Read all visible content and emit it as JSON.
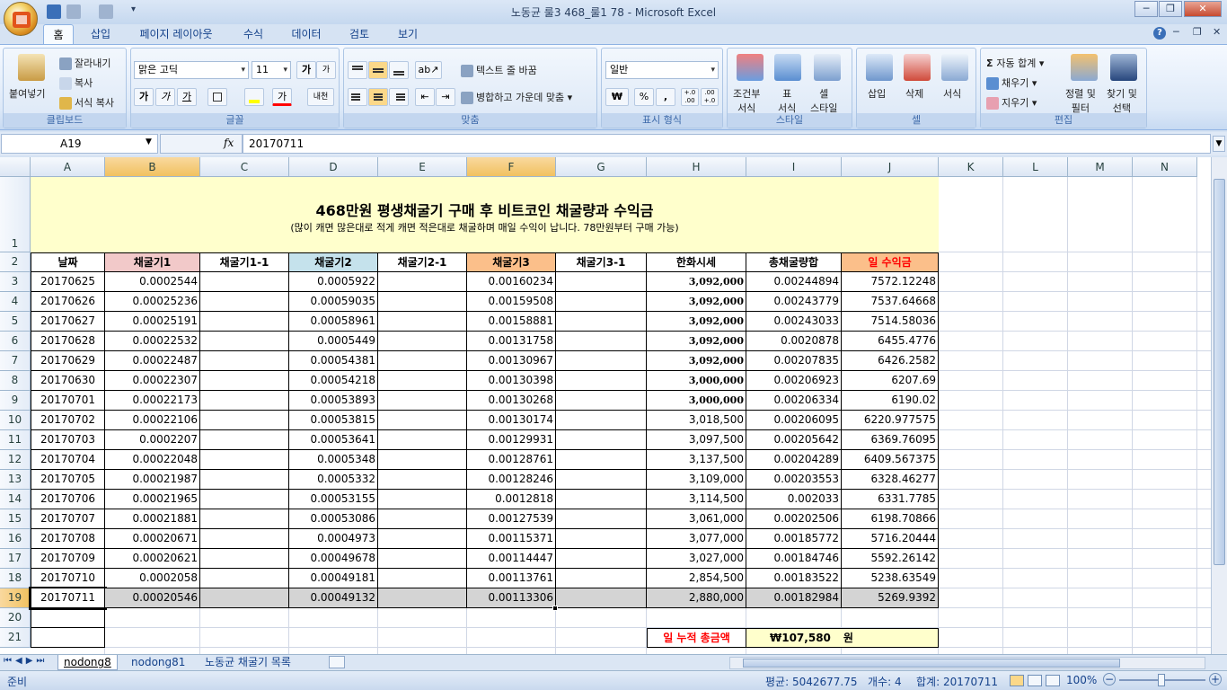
{
  "window": {
    "title": "노동균 룰3 468_룰1 78 - Microsoft Excel",
    "controls": {
      "minimize": "─",
      "maximize": "❐",
      "close": "✕"
    },
    "inner_controls": {
      "help": "?",
      "minimize": "─",
      "restore": "❐",
      "close": "✕"
    }
  },
  "tabs": [
    {
      "label": "홈",
      "active": true
    },
    {
      "label": "삽입"
    },
    {
      "label": "페이지 레이아웃"
    },
    {
      "label": "수식"
    },
    {
      "label": "데이터"
    },
    {
      "label": "검토"
    },
    {
      "label": "보기"
    }
  ],
  "ribbon": {
    "clipboard": {
      "label": "클립보드",
      "paste": "붙여넣기",
      "cut": "잘라내기",
      "copy": "복사",
      "format_painter": "서식 복사"
    },
    "font": {
      "label": "글꼴",
      "font_name": "맑은 고딕",
      "font_size": "11",
      "grow": "가",
      "shrink": "가",
      "bold": "가",
      "italic": "가",
      "underline": "가",
      "font_color": "가",
      "phonetic": "내천"
    },
    "alignment": {
      "label": "맞춤",
      "wrap_text": "텍스트 줄 바꿈",
      "merge": "병합하고 가운데 맞춤"
    },
    "number": {
      "label": "표시 형식",
      "format": "일반",
      "currency": "₩",
      "percent": "%",
      "comma": ",",
      "inc_decimal": "+.0 .00",
      "dec_decimal": ".00 +.0"
    },
    "styles": {
      "label": "스타일",
      "conditional": [
        "조건부",
        "서식"
      ],
      "table": [
        "표",
        "서식"
      ],
      "cell": [
        "셀",
        "스타일"
      ]
    },
    "cells": {
      "label": "셀",
      "insert": "삽입",
      "delete": "삭제",
      "format": "서식"
    },
    "editing": {
      "label": "편집",
      "autosum": "자동 합계",
      "fill": "채우기",
      "clear": "지우기",
      "sort": [
        "정렬 및",
        "필터"
      ],
      "find": [
        "찾기 및",
        "선택"
      ]
    }
  },
  "formula_bar": {
    "name_box": "A19",
    "fx": "fx",
    "formula": "20170711"
  },
  "columns": [
    "A",
    "B",
    "C",
    "D",
    "E",
    "F",
    "G",
    "H",
    "I",
    "J",
    "K",
    "L",
    "M",
    "N"
  ],
  "rows": [
    "1",
    "2",
    "3",
    "4",
    "5",
    "6",
    "7",
    "8",
    "9",
    "10",
    "11",
    "12",
    "13",
    "14",
    "15",
    "16",
    "17",
    "18",
    "19",
    "20",
    "21"
  ],
  "sheet": {
    "title": "468만원 평생채굴기 구매 후 비트코인 채굴량과 수익금",
    "subtitle": "(많이 캐면 많은대로 적게 캐면 적은대로 채굴하며 매일 수익이 납니다. 78만원부터 구매 가능)",
    "headers": [
      "날짜",
      "채굴기1",
      "채굴기1-1",
      "채굴기2",
      "채굴기2-1",
      "채굴기3",
      "채굴기3-1",
      "한화시세",
      "총채굴량합",
      "일 수익금"
    ],
    "rows": [
      [
        "20170625",
        "0.0002544",
        "",
        "0.0005922",
        "",
        "0.00160234",
        "",
        "3,092,000",
        "0.00244894",
        "7572.12248"
      ],
      [
        "20170626",
        "0.00025236",
        "",
        "0.00059035",
        "",
        "0.00159508",
        "",
        "3,092,000",
        "0.00243779",
        "7537.64668"
      ],
      [
        "20170627",
        "0.00025191",
        "",
        "0.00058961",
        "",
        "0.00158881",
        "",
        "3,092,000",
        "0.00243033",
        "7514.58036"
      ],
      [
        "20170628",
        "0.00022532",
        "",
        "0.0005449",
        "",
        "0.00131758",
        "",
        "3,092,000",
        "0.0020878",
        "6455.4776"
      ],
      [
        "20170629",
        "0.00022487",
        "",
        "0.00054381",
        "",
        "0.00130967",
        "",
        "3,092,000",
        "0.00207835",
        "6426.2582"
      ],
      [
        "20170630",
        "0.00022307",
        "",
        "0.00054218",
        "",
        "0.00130398",
        "",
        "3,000,000",
        "0.00206923",
        "6207.69"
      ],
      [
        "20170701",
        "0.00022173",
        "",
        "0.00053893",
        "",
        "0.00130268",
        "",
        "3,000,000",
        "0.00206334",
        "6190.02"
      ],
      [
        "20170702",
        "0.00022106",
        "",
        "0.00053815",
        "",
        "0.00130174",
        "",
        "3,018,500",
        "0.00206095",
        "6220.977575"
      ],
      [
        "20170703",
        "0.0002207",
        "",
        "0.00053641",
        "",
        "0.00129931",
        "",
        "3,097,500",
        "0.00205642",
        "6369.76095"
      ],
      [
        "20170704",
        "0.00022048",
        "",
        "0.0005348",
        "",
        "0.00128761",
        "",
        "3,137,500",
        "0.00204289",
        "6409.567375"
      ],
      [
        "20170705",
        "0.00021987",
        "",
        "0.0005332",
        "",
        "0.00128246",
        "",
        "3,109,000",
        "0.00203553",
        "6328.46277"
      ],
      [
        "20170706",
        "0.00021965",
        "",
        "0.00053155",
        "",
        "0.0012818",
        "",
        "3,114,500",
        "0.002033",
        "6331.7785"
      ],
      [
        "20170707",
        "0.00021881",
        "",
        "0.00053086",
        "",
        "0.00127539",
        "",
        "3,061,000",
        "0.00202506",
        "6198.70866"
      ],
      [
        "20170708",
        "0.00020671",
        "",
        "0.0004973",
        "",
        "0.00115371",
        "",
        "3,077,000",
        "0.00185772",
        "5716.20444"
      ],
      [
        "20170709",
        "0.00020621",
        "",
        "0.00049678",
        "",
        "0.00114447",
        "",
        "3,027,000",
        "0.00184746",
        "5592.26142"
      ],
      [
        "20170710",
        "0.0002058",
        "",
        "0.00049181",
        "",
        "0.00113761",
        "",
        "2,854,500",
        "0.00183522",
        "5238.63549"
      ],
      [
        "20170711",
        "0.00020546",
        "",
        "0.00049132",
        "",
        "0.00113306",
        "",
        "2,880,000",
        "0.00182984",
        "5269.9392"
      ]
    ],
    "total_label": "일 누적 총금액",
    "total_value": "₩107,580",
    "total_unit": "원"
  },
  "sheet_tabs": [
    {
      "label": "nodong8",
      "active": true
    },
    {
      "label": "nodong81"
    },
    {
      "label": "노동균 채굴기 목록"
    }
  ],
  "status": {
    "mode": "준비",
    "average": "평균: 5042677.75",
    "count": "개수: 4",
    "sum": "합계: 20170711",
    "zoom": "100%"
  },
  "colors": {
    "title_fill": "#ffffcc",
    "miner1_fill": "#f2c9c9",
    "miner2_fill": "#c5e2ec",
    "miner3_fill": "#fbbf8a",
    "profit_fill": "#fbbf8a",
    "profit_text": "#ff0000",
    "total_text": "#ff0000",
    "total_fill": "#ffffcc",
    "selection_fill": "#d4d4d4"
  }
}
